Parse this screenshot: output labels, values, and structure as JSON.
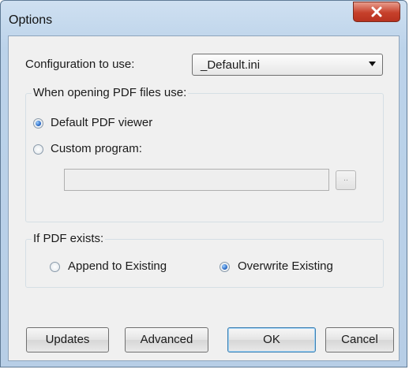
{
  "window": {
    "title": "Options"
  },
  "config": {
    "label": "Configuration to use:",
    "value": "_Default.ini"
  },
  "pdf_open_group": {
    "title": "When opening PDF files use:",
    "default_option": "Default PDF viewer",
    "custom_option": "Custom program:",
    "custom_path": "",
    "browse_label": "..",
    "selected": "Default PDF viewer"
  },
  "exists_group": {
    "title": "If PDF exists:",
    "append_option": "Append to Existing",
    "overwrite_option": "Overwrite Existing",
    "selected": "Overwrite Existing"
  },
  "buttons": {
    "updates": "Updates",
    "advanced": "Advanced",
    "ok": "OK",
    "cancel": "Cancel"
  },
  "icons": {
    "close": "close-x-icon",
    "dropdown": "chevron-down-icon"
  }
}
